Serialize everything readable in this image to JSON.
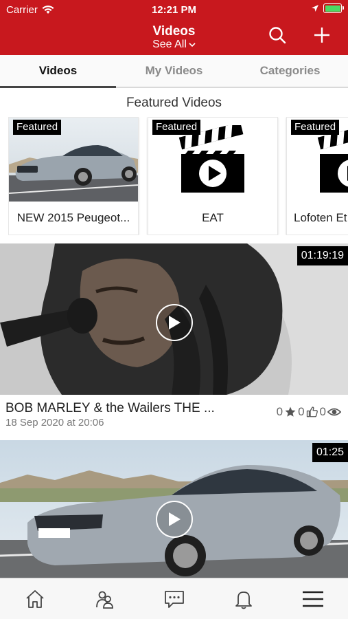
{
  "status_bar": {
    "carrier": "Carrier",
    "time": "12:21 PM"
  },
  "header": {
    "title": "Videos",
    "subtitle": "See All",
    "search_icon": "search-icon",
    "add_icon": "plus-icon"
  },
  "tabs": [
    {
      "label": "Videos",
      "active": true
    },
    {
      "label": "My Videos",
      "active": false
    },
    {
      "label": "Categories",
      "active": false
    }
  ],
  "featured": {
    "section_title": "Featured Videos",
    "badge": "Featured",
    "items": [
      {
        "caption": "NEW 2015 Peugeot..."
      },
      {
        "caption": "EAT"
      },
      {
        "caption": "Lofoten Et"
      }
    ]
  },
  "videos": [
    {
      "duration": "01:19:19",
      "title": "BOB MARLEY & the Wailers THE ...",
      "date": "18 Sep 2020 at 20:06",
      "rating": "0",
      "likes": "0",
      "views": "0"
    },
    {
      "duration": "01:25"
    }
  ],
  "colors": {
    "brand": "#c8181e"
  },
  "bottom_nav": [
    "home-icon",
    "users-icon",
    "chat-icon",
    "bell-icon",
    "menu-icon"
  ]
}
